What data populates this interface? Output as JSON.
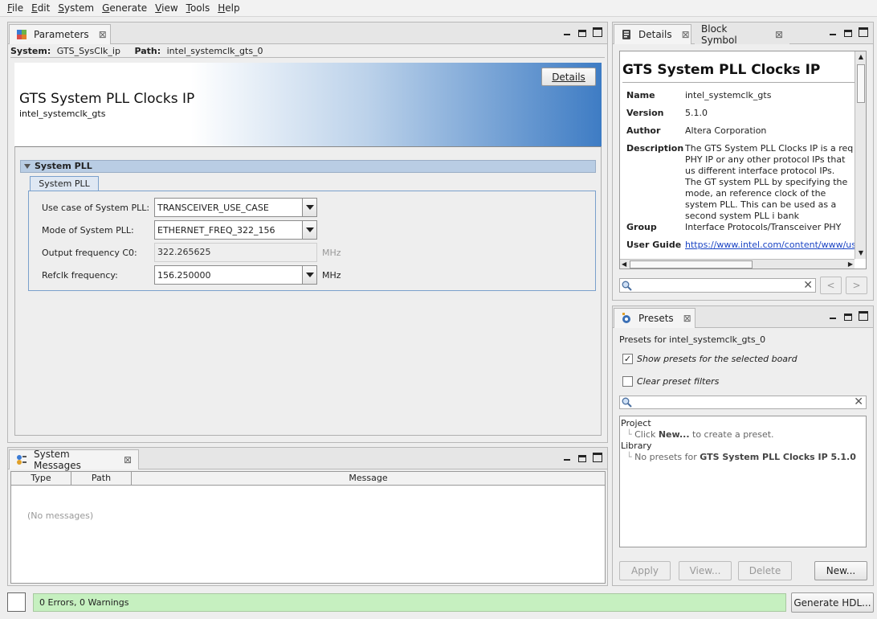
{
  "menu": [
    "File",
    "Edit",
    "System",
    "Generate",
    "View",
    "Tools",
    "Help"
  ],
  "menu_mnemonics": [
    "F",
    "E",
    "S",
    "G",
    "V",
    "T",
    "H"
  ],
  "parameters": {
    "tab_label": "Parameters",
    "system_label": "System:",
    "system_value": "GTS_SysClk_ip",
    "path_label": "Path:",
    "path_value": "intel_systemclk_gts_0",
    "details_button": "Details",
    "ip_title": "GTS System PLL Clocks IP",
    "ip_name": "intel_systemclk_gts",
    "group_title": "System PLL",
    "inner_tab": "System PLL",
    "fields": [
      {
        "label": "Use case of System PLL:",
        "value": "TRANSCEIVER_USE_CASE",
        "kind": "combo",
        "unit": ""
      },
      {
        "label": "Mode of System PLL:",
        "value": "ETHERNET_FREQ_322_156",
        "kind": "combo",
        "unit": ""
      },
      {
        "label": "Output frequency C0:",
        "value": "322.265625",
        "kind": "readonly",
        "unit": "MHz"
      },
      {
        "label": "Refclk frequency:",
        "value": "156.250000",
        "kind": "combo",
        "unit": "MHz"
      }
    ]
  },
  "messages": {
    "tab_label": "System Messages",
    "columns": [
      "Type",
      "Path",
      "Message"
    ],
    "empty_text": "(No messages)"
  },
  "details": {
    "tab_label": "Details",
    "tab2_label": "Block Symbol",
    "title": "GTS System PLL Clocks IP",
    "rows": [
      {
        "key": "Name",
        "value": "intel_systemclk_gts"
      },
      {
        "key": "Version",
        "value": "5.1.0"
      },
      {
        "key": "Author",
        "value": "Altera Corporation"
      },
      {
        "key": "Description",
        "value": "The GTS System PLL Clocks IP is a req PHY IP or any other protocol IPs that us different interface protocol IPs. The GT system PLL by specifying the mode, an reference clock of the system PLL. This can be used as a second system PLL i bank"
      },
      {
        "key": "Group",
        "value": "Interface Protocols/Transceiver PHY"
      },
      {
        "key": "User Guide",
        "value": "https://www.intel.com/content/www/us"
      }
    ],
    "nav_prev": "<",
    "nav_next": ">"
  },
  "presets": {
    "tab_label": "Presets",
    "presets_for": "Presets for intel_systemclk_gts_0",
    "show_board_label": "Show presets for the selected board",
    "show_board_checked": true,
    "clear_filters_label": "Clear preset filters",
    "clear_filters_checked": false,
    "tree": {
      "project_label": "Project",
      "project_hint_pre": "Click ",
      "project_hint_bold": "New...",
      "project_hint_post": " to create a preset.",
      "library_label": "Library",
      "library_hint_pre": "No presets for ",
      "library_hint_bold": "GTS System PLL Clocks IP 5.1.0"
    },
    "buttons": {
      "apply": "Apply",
      "view": "View...",
      "delete": "Delete",
      "new": "New..."
    }
  },
  "status": {
    "text": "0 Errors, 0 Warnings",
    "generate_button": "Generate HDL...",
    "color": "#c6f0c0"
  }
}
